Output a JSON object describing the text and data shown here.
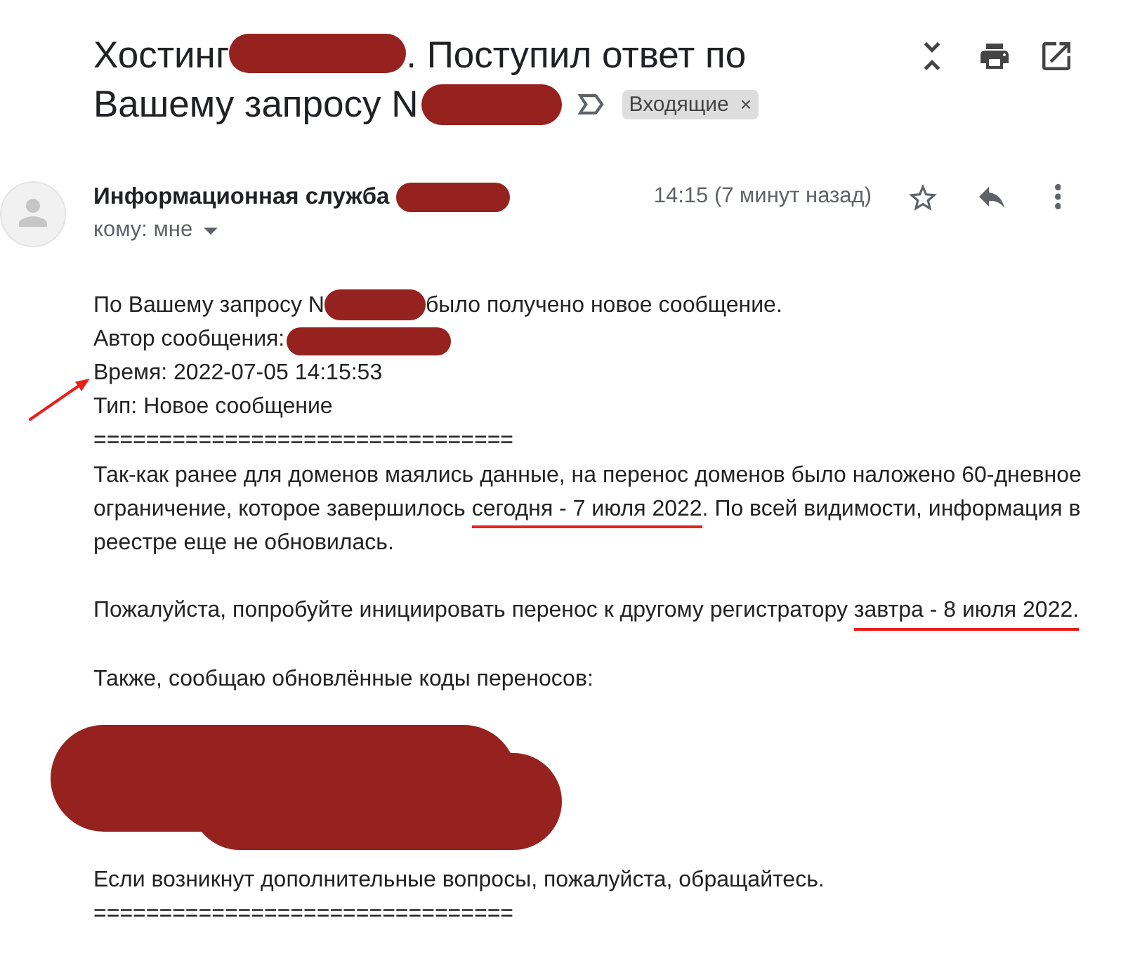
{
  "subject": {
    "segments": [
      {
        "kind": "text",
        "text": "Хостинг"
      },
      {
        "kind": "redaction"
      },
      {
        "kind": "text",
        "text": ". Поступил ответ по"
      },
      {
        "kind": "text",
        "text": "Вашему запросу N"
      },
      {
        "kind": "redaction"
      }
    ],
    "important": false,
    "label": {
      "text": "Входящие",
      "remove": "×"
    }
  },
  "message": {
    "sender": [
      {
        "kind": "text",
        "text": "Информационная служба"
      },
      {
        "kind": "redaction"
      }
    ],
    "recipient": "кому: мне",
    "time": "14:15 (7 минут назад)",
    "starred": false
  },
  "body": {
    "sections": [
      [
        {
          "kind": "text",
          "pointed": false,
          "segments": [
            {
              "kind": "text",
              "text": "По Вашему запросу N"
            },
            {
              "kind": "redaction"
            },
            {
              "kind": "text",
              "text": "было получено новое сообщение."
            }
          ]
        },
        {
          "kind": "text",
          "pointed": false,
          "segments": [
            {
              "kind": "text",
              "text": "Автор сообщения:"
            },
            {
              "kind": "redaction"
            }
          ]
        },
        {
          "kind": "text",
          "pointed": true,
          "segments": [
            {
              "kind": "text",
              "text": "Время: 2022-07-05 14:15:53"
            }
          ]
        },
        {
          "kind": "text",
          "pointed": false,
          "segments": [
            {
              "kind": "text",
              "text": "Тип: Новое сообщение"
            }
          ]
        },
        {
          "kind": "text",
          "pointed": false,
          "segments": [
            {
              "kind": "text",
              "text": "================================"
            }
          ]
        },
        {
          "kind": "text",
          "pointed": false,
          "segments": [
            {
              "kind": "text",
              "text": "Так-как ранее для доменов маялись данные, на перенос доменов было наложено 60-дневное ограничение, которое завершилось "
            },
            {
              "kind": "underlined",
              "text": "сегодня - 7 июля 2022"
            },
            {
              "kind": "text",
              "text": ". По всей видимости, информация в реестре еще не обновилась."
            }
          ]
        }
      ],
      [
        {
          "kind": "text",
          "pointed": false,
          "segments": [
            {
              "kind": "text",
              "text": "Пожалуйста, попробуйте инициировать перенос к другому регистратору "
            },
            {
              "kind": "underlined",
              "text": "завтра - 8 июля 2022."
            }
          ]
        }
      ],
      [
        {
          "kind": "text",
          "pointed": false,
          "segments": [
            {
              "kind": "text",
              "text": "Также, сообщаю обновлённые коды переносов:"
            }
          ]
        },
        {
          "kind": "redaction"
        },
        {
          "kind": "text",
          "pointed": false,
          "segments": [
            {
              "kind": "text",
              "text": "Если возникнут дополнительные вопросы, пожалуйста, обращайтесь."
            }
          ]
        },
        {
          "kind": "text",
          "pointed": false,
          "segments": [
            {
              "kind": "text",
              "text": "================================"
            }
          ]
        }
      ]
    ]
  }
}
